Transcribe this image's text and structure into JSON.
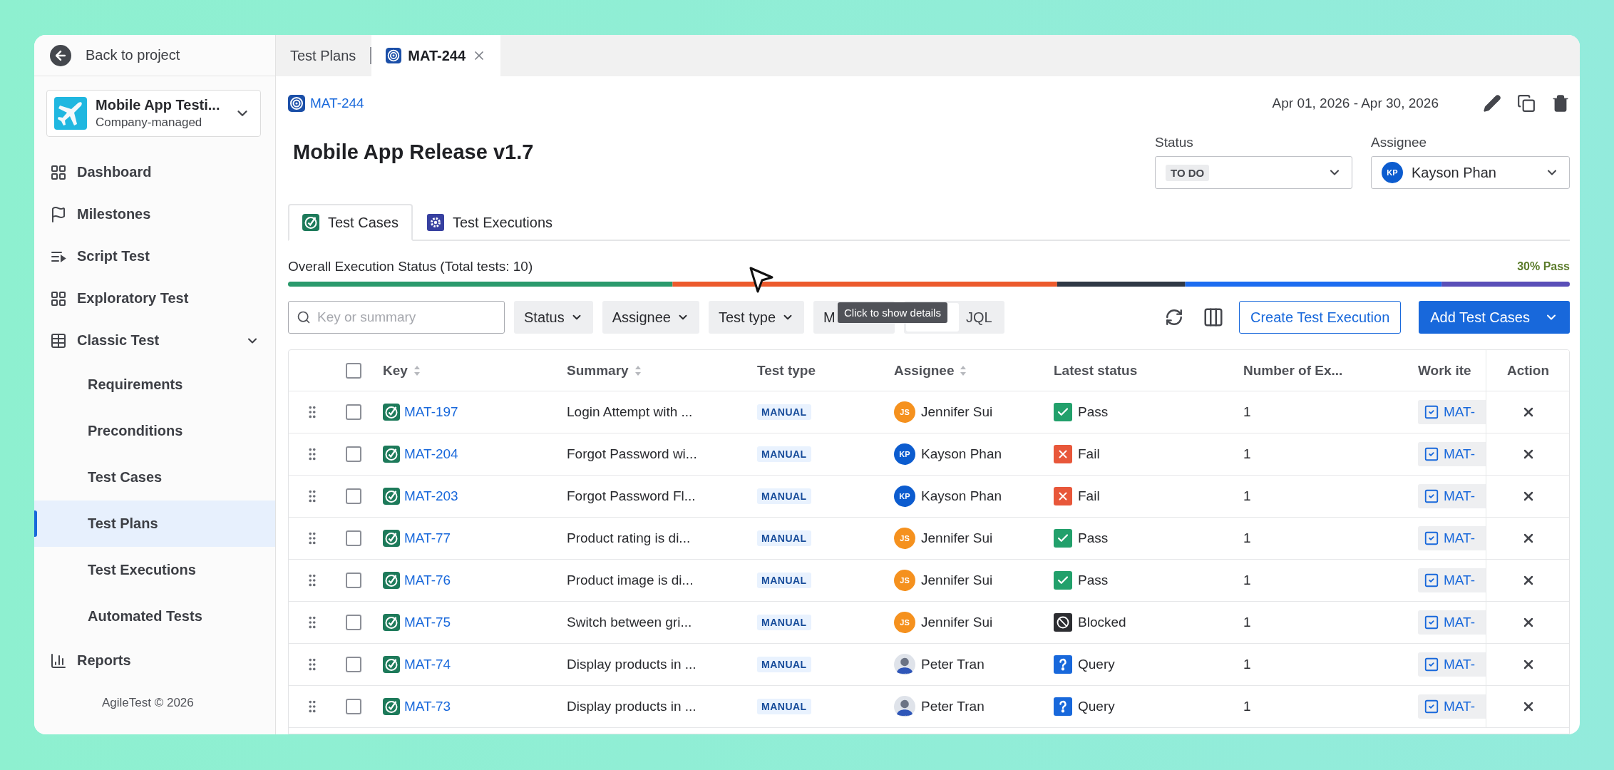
{
  "sidebar": {
    "back_link": "Back to project",
    "project": {
      "name": "Mobile App Testi...",
      "type": "Company-managed"
    },
    "nav": [
      {
        "label": "Dashboard",
        "selected": false
      },
      {
        "label": "Milestones",
        "selected": false
      },
      {
        "label": "Script Test",
        "selected": false
      },
      {
        "label": "Exploratory Test",
        "selected": false
      },
      {
        "label": "Classic Test",
        "selected": false,
        "expanded": true,
        "children": [
          {
            "label": "Requirements",
            "selected": false
          },
          {
            "label": "Preconditions",
            "selected": false
          },
          {
            "label": "Test Cases",
            "selected": false
          },
          {
            "label": "Test Plans",
            "selected": true
          },
          {
            "label": "Test Executions",
            "selected": false
          },
          {
            "label": "Automated Tests",
            "selected": false
          }
        ]
      },
      {
        "label": "Reports",
        "selected": false
      }
    ],
    "footer": "AgileTest © 2026"
  },
  "tabs": [
    {
      "label": "Test Plans",
      "kind": "page",
      "selected": false,
      "closable": false
    },
    {
      "label": "MAT-244",
      "kind": "plan",
      "selected": true,
      "closable": true
    }
  ],
  "header": {
    "breadcrumb": "MAT-244",
    "title": "Mobile App Release v1.7",
    "date_range": "Apr 01, 2026 - Apr 30, 2026",
    "status": {
      "label": "Status",
      "value": "TO DO"
    },
    "assignee": {
      "label": "Assignee",
      "name": "Kayson Phan",
      "initials": "KP",
      "color": "#0c5ccf"
    }
  },
  "content_tabs": [
    {
      "label": "Test Cases",
      "kind": "cases",
      "selected": true
    },
    {
      "label": "Test Executions",
      "kind": "executions",
      "selected": false
    }
  ],
  "execution_status": {
    "label": "Overall Execution Status (Total tests: 10)",
    "summary": "30% Pass"
  },
  "toolbar": {
    "search": {
      "placeholder": "Key or summary"
    },
    "filters": [
      "Status",
      "Assignee",
      "Test type",
      "M"
    ],
    "query_mode": "JQL",
    "tooltip": "Click to show details",
    "create_button": "Create Test Execution",
    "add_button": "Add Test Cases"
  },
  "table": {
    "header_checked": false,
    "columns": [
      {
        "label": "Key",
        "sortable": true
      },
      {
        "label": "Summary",
        "sortable": true
      },
      {
        "label": "Test type",
        "sortable": false
      },
      {
        "label": "Assignee",
        "sortable": true
      },
      {
        "label": "Latest status",
        "sortable": false
      },
      {
        "label": "Number of Ex...",
        "sortable": false
      },
      {
        "label": "Work ite",
        "sortable": false
      },
      {
        "label": "Action",
        "sortable": false
      }
    ],
    "rows": [
      {
        "key": "MAT-197",
        "summary": "Login Attempt with ...",
        "test_type": "MANUAL",
        "assignee": {
          "name": "Jennifer Sui",
          "kind": "initials",
          "initials": "JS",
          "color": "#f5911e"
        },
        "latest_status": {
          "kind": "pass",
          "label": "Pass"
        },
        "executions": "1",
        "work_item": "MAT-",
        "checked": false
      },
      {
        "key": "MAT-204",
        "summary": "Forgot Password wi...",
        "test_type": "MANUAL",
        "assignee": {
          "name": "Kayson Phan",
          "kind": "initials",
          "initials": "KP",
          "color": "#0c5ccf"
        },
        "latest_status": {
          "kind": "fail",
          "label": "Fail"
        },
        "executions": "1",
        "work_item": "MAT-",
        "checked": false
      },
      {
        "key": "MAT-203",
        "summary": "Forgot Password Fl...",
        "test_type": "MANUAL",
        "assignee": {
          "name": "Kayson Phan",
          "kind": "initials",
          "initials": "KP",
          "color": "#0c5ccf"
        },
        "latest_status": {
          "kind": "fail",
          "label": "Fail"
        },
        "executions": "1",
        "work_item": "MAT-",
        "checked": false
      },
      {
        "key": "MAT-77",
        "summary": "Product rating is di...",
        "test_type": "MANUAL",
        "assignee": {
          "name": "Jennifer Sui",
          "kind": "initials",
          "initials": "JS",
          "color": "#f5911e"
        },
        "latest_status": {
          "kind": "pass",
          "label": "Pass"
        },
        "executions": "1",
        "work_item": "MAT-",
        "checked": false
      },
      {
        "key": "MAT-76",
        "summary": "Product image is di...",
        "test_type": "MANUAL",
        "assignee": {
          "name": "Jennifer Sui",
          "kind": "initials",
          "initials": "JS",
          "color": "#f5911e"
        },
        "latest_status": {
          "kind": "pass",
          "label": "Pass"
        },
        "executions": "1",
        "work_item": "MAT-",
        "checked": false
      },
      {
        "key": "MAT-75",
        "summary": "Switch between gri...",
        "test_type": "MANUAL",
        "assignee": {
          "name": "Jennifer Sui",
          "kind": "initials",
          "initials": "JS",
          "color": "#f5911e"
        },
        "latest_status": {
          "kind": "blocked",
          "label": "Blocked"
        },
        "executions": "1",
        "work_item": "MAT-",
        "checked": false
      },
      {
        "key": "MAT-74",
        "summary": "Display products in ...",
        "test_type": "MANUAL",
        "assignee": {
          "name": "Peter Tran",
          "kind": "photo"
        },
        "latest_status": {
          "kind": "query",
          "label": "Query"
        },
        "executions": "1",
        "work_item": "MAT-",
        "checked": false
      },
      {
        "key": "MAT-73",
        "summary": "Display products in ...",
        "test_type": "MANUAL",
        "assignee": {
          "name": "Peter Tran",
          "kind": "photo"
        },
        "latest_status": {
          "kind": "query",
          "label": "Query"
        },
        "executions": "1",
        "work_item": "MAT-",
        "checked": false
      }
    ]
  }
}
